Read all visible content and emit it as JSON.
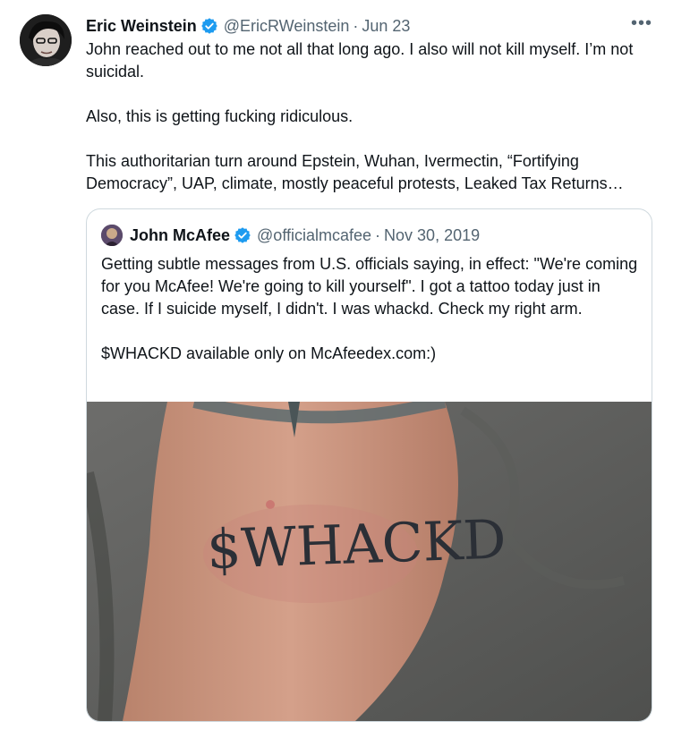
{
  "tweet": {
    "author_name": "Eric Weinstein",
    "handle": "@EricRWeinstein",
    "separator": "·",
    "date": "Jun 23",
    "more_label": "•••",
    "text": "John reached out to me not all that long ago. I also will not kill myself. I’m not suicidal.\n\nAlso, this is getting fucking ridiculous.\n\nThis authoritarian turn around Epstein, Wuhan, Ivermectin, “Fortifying Democracy”, UAP, climate, mostly peaceful protests, Leaked Tax Returns…"
  },
  "quoted_tweet": {
    "author_name": "John McAfee",
    "handle": "@officialmcafee",
    "separator": "·",
    "date": "Nov 30, 2019",
    "text": "Getting subtle messages from U.S. officials saying, in effect: \"We're coming for you McAfee! We're going to kill yourself\". I got a tattoo today just in case. If I suicide myself, I didn't. I was whackd. Check my right arm.\n\n$WHACKD available only on McAfeedex.com:)",
    "image_tattoo_text": "$WHACKD"
  },
  "colors": {
    "text": "#0f1419",
    "muted": "#536471",
    "verified_blue": "#1d9bf0",
    "border": "#cfd9de"
  }
}
